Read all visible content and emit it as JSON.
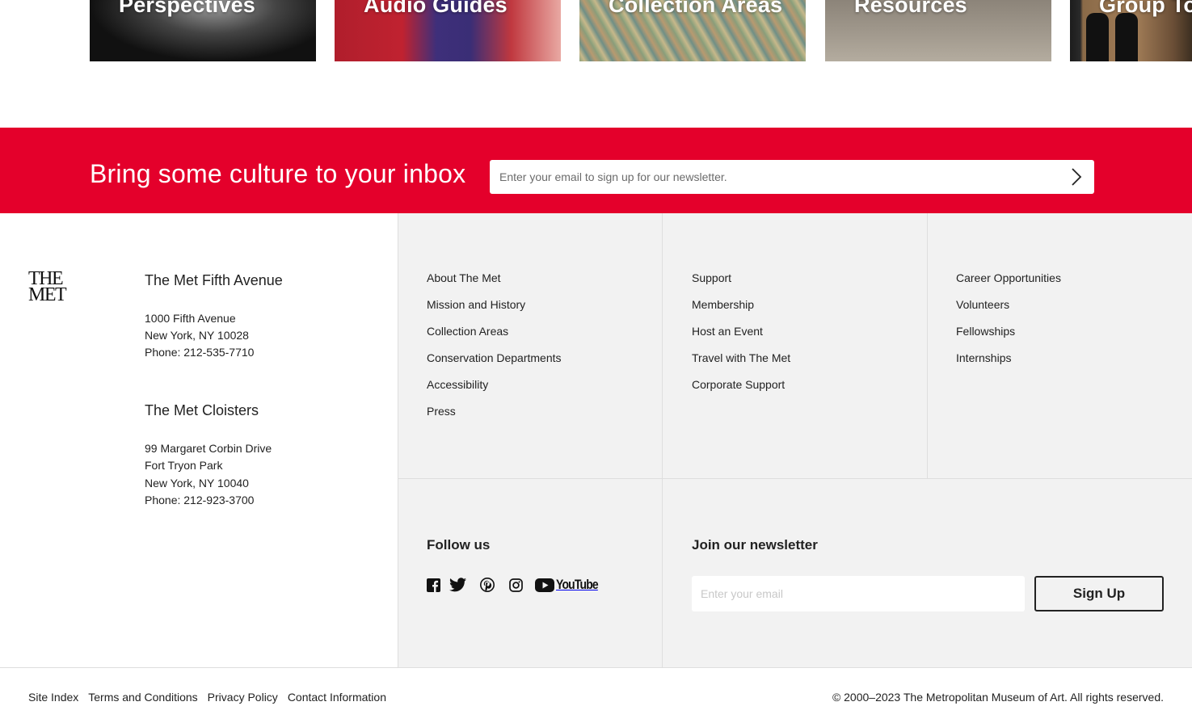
{
  "cards": [
    {
      "label": "Perspectives"
    },
    {
      "label": "Audio Guides"
    },
    {
      "label": "Collection Areas"
    },
    {
      "label": "Resources"
    },
    {
      "label": "Group Tou"
    }
  ],
  "newsletter_band": {
    "title": "Bring some culture to your inbox",
    "placeholder": "Enter your email to sign up for our newsletter.",
    "submit_icon": "chevron-right-icon"
  },
  "logo": {
    "line1": "THE",
    "line2": "MET"
  },
  "locations": [
    {
      "title": "The Met Fifth Avenue",
      "lines": [
        "1000 Fifth Avenue",
        "New York, NY 10028",
        "Phone: 212-535-7710"
      ]
    },
    {
      "title": "The Met Cloisters",
      "lines": [
        "99 Margaret Corbin Drive",
        "Fort Tryon Park",
        "New York, NY 10040",
        "Phone: 212-923-3700"
      ]
    }
  ],
  "link_columns": [
    [
      "About The Met",
      "Mission and History",
      "Collection Areas",
      "Conservation Departments",
      "Accessibility",
      "Press"
    ],
    [
      "Support",
      "Membership",
      "Host an Event",
      "Travel with The Met",
      "Corporate Support"
    ],
    [
      "Career Opportunities",
      "Volunteers",
      "Fellowships",
      "Internships"
    ]
  ],
  "follow": {
    "title": "Follow us",
    "icons": [
      "facebook-icon",
      "twitter-icon",
      "pinterest-icon",
      "instagram-icon",
      "youtube-icon"
    ],
    "youtube_word": "YouTube"
  },
  "join": {
    "title": "Join our newsletter",
    "placeholder": "Enter your email",
    "button": "Sign Up"
  },
  "bottom_links": [
    "Site Index",
    "Terms and Conditions",
    "Privacy Policy",
    "Contact Information"
  ],
  "copyright": "© 2000–2023 The Metropolitan Museum of Art. All rights reserved.",
  "colors": {
    "brand_red": "#e4002b",
    "footer_grey": "#f2f2f2",
    "text": "#222222"
  }
}
